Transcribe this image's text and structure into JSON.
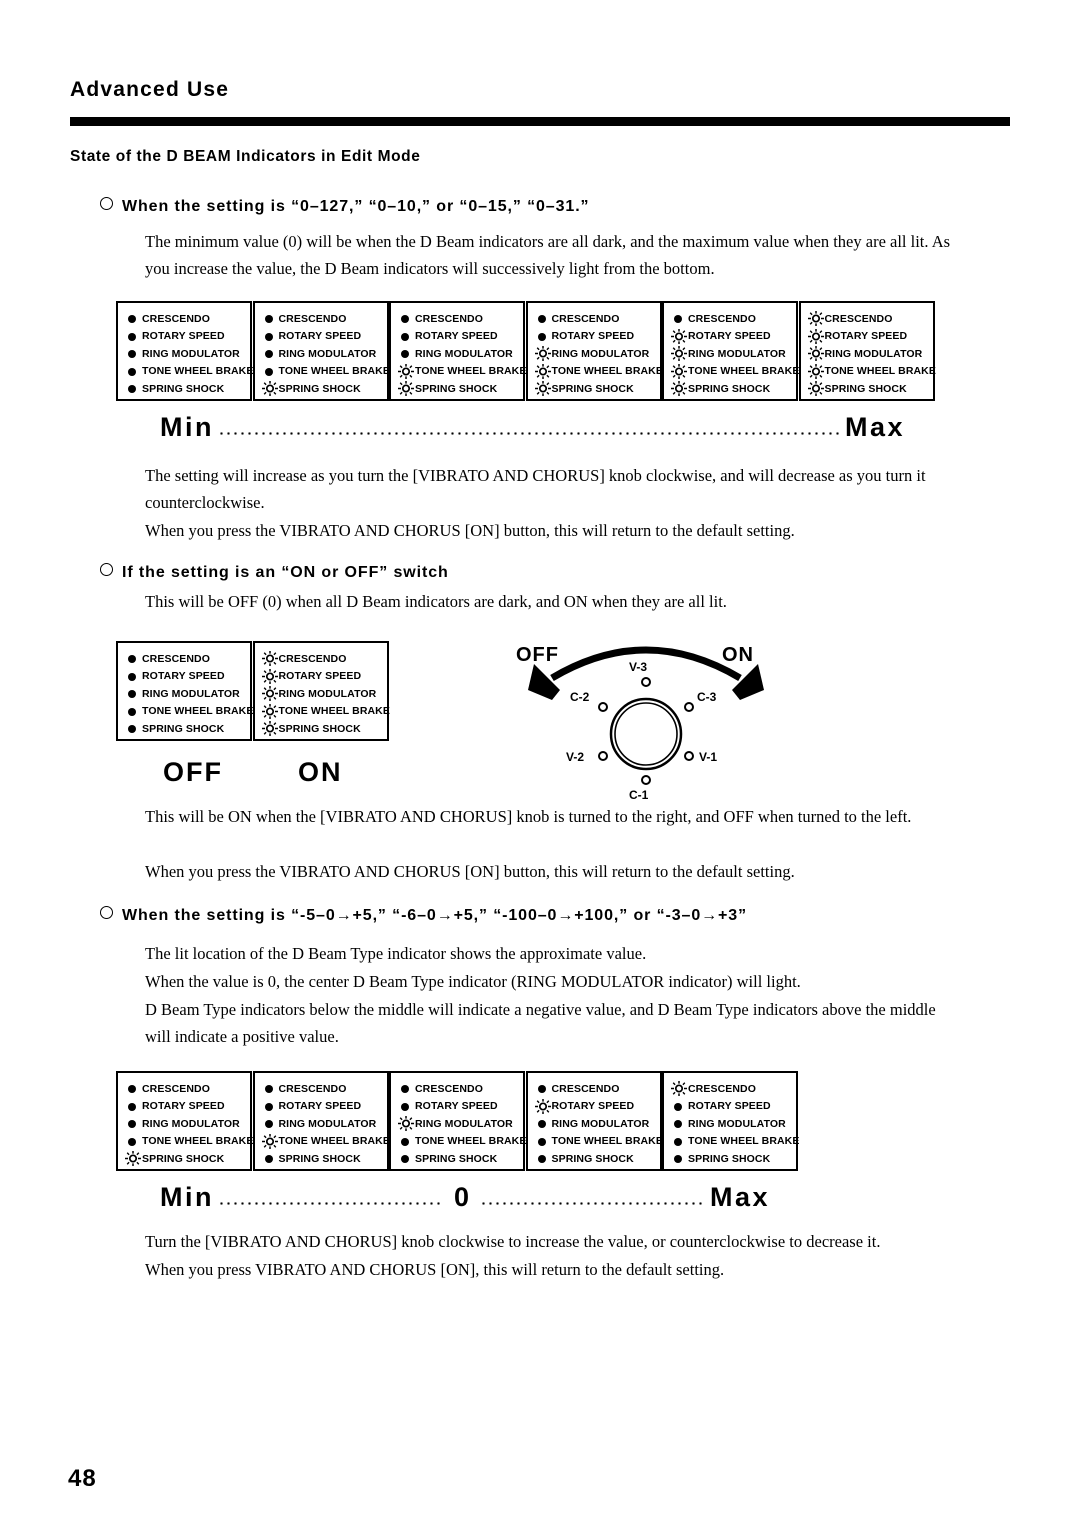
{
  "header": {
    "chapter_title": "Advanced Use"
  },
  "section": {
    "title": "State of the D BEAM Indicators in Edit Mode"
  },
  "subsections": [
    {
      "heading": "When the setting is “0–127,” “0–10,” or “0–15,” “0–31.”",
      "paragraphs": [
        "The minimum value (0) will be when the D Beam indicators are all dark, and the maximum value when they are all lit. As you increase the value, the D Beam indicators will successively light from the bottom.",
        "The setting will increase as you turn the [VIBRATO AND CHORUS] knob clockwise, and will decrease as you turn it counterclockwise.",
        "When you press the VIBRATO AND CHORUS [ON] button, this will return to the default setting."
      ]
    },
    {
      "heading": "If the setting is an “ON or OFF” switch",
      "paragraphs": [
        "This will be OFF (0) when all D Beam indicators are dark, and ON when they are all lit.",
        "This will be ON when the [VIBRATO AND CHORUS] knob is turned to the right, and OFF when turned to the left.",
        "When you press the VIBRATO AND CHORUS [ON] button, this will return to the default setting."
      ]
    },
    {
      "heading": "When the setting is “-5–0→+5,” “-6–0→+5,” “-100–0→+100,” or “-3–0→+3”",
      "paragraphs": [
        "The lit location of the D Beam Type indicator shows the approximate value.",
        "When the value is 0, the center D Beam Type indicator (RING MODULATOR indicator) will light.",
        "D Beam Type indicators below the middle will indicate a negative value, and D Beam Type indicators above the middle will indicate a positive value.",
        "Turn the [VIBRATO AND CHORUS] knob clockwise to increase the value, or counterclockwise to decrease it.",
        "When you press VIBRATO AND CHORUS [ON], this will return to the default setting."
      ]
    }
  ],
  "indicator_labels": [
    "CRESCENDO",
    "ROTARY SPEED",
    "RING MODULATOR",
    "TONE WHEEL BRAKE",
    "SPRING SHOCK"
  ],
  "panel_rows": {
    "ramp": {
      "description": "Progressive lighting from the bottom, Min to Max",
      "panels": [
        {
          "states": [
            "dark",
            "dark",
            "dark",
            "dark",
            "dark"
          ]
        },
        {
          "states": [
            "dark",
            "dark",
            "dark",
            "dark",
            "lit"
          ]
        },
        {
          "states": [
            "dark",
            "dark",
            "dark",
            "lit",
            "lit"
          ]
        },
        {
          "states": [
            "dark",
            "dark",
            "lit",
            "lit",
            "lit"
          ]
        },
        {
          "states": [
            "dark",
            "lit",
            "lit",
            "lit",
            "lit"
          ]
        },
        {
          "states": [
            "lit",
            "lit",
            "lit",
            "lit",
            "lit"
          ]
        }
      ],
      "scale": {
        "left": "Min",
        "right": "Max"
      }
    },
    "onoff": {
      "description": "OFF = all dark, ON = all lit",
      "panels": [
        {
          "states": [
            "dark",
            "dark",
            "dark",
            "dark",
            "dark"
          ]
        },
        {
          "states": [
            "lit",
            "lit",
            "lit",
            "lit",
            "lit"
          ]
        }
      ],
      "labels": {
        "off": "OFF",
        "on": "ON"
      }
    },
    "bipolar": {
      "description": "Single lit indicator moving from bottom to top, Min through 0 to Max",
      "panels": [
        {
          "states": [
            "dark",
            "dark",
            "dark",
            "dark",
            "lit"
          ]
        },
        {
          "states": [
            "dark",
            "dark",
            "dark",
            "lit",
            "dark"
          ]
        },
        {
          "states": [
            "dark",
            "dark",
            "lit",
            "dark",
            "dark"
          ]
        },
        {
          "states": [
            "dark",
            "lit",
            "dark",
            "dark",
            "dark"
          ]
        },
        {
          "states": [
            "lit",
            "dark",
            "dark",
            "dark",
            "dark"
          ]
        }
      ],
      "scale": {
        "left": "Min",
        "center": "0",
        "right": "Max"
      }
    }
  },
  "knob_diagram": {
    "off_label": "OFF",
    "on_label": "ON",
    "positions": [
      {
        "name": "V-3",
        "place": "top"
      },
      {
        "name": "C-2",
        "place": "upper-left"
      },
      {
        "name": "C-3",
        "place": "upper-right"
      },
      {
        "name": "V-2",
        "place": "lower-left"
      },
      {
        "name": "V-1",
        "place": "lower-right"
      },
      {
        "name": "C-1",
        "place": "bottom"
      }
    ]
  },
  "footer": {
    "page_number": "48"
  },
  "colors": {
    "ink": "#000000",
    "paper": "#ffffff"
  }
}
